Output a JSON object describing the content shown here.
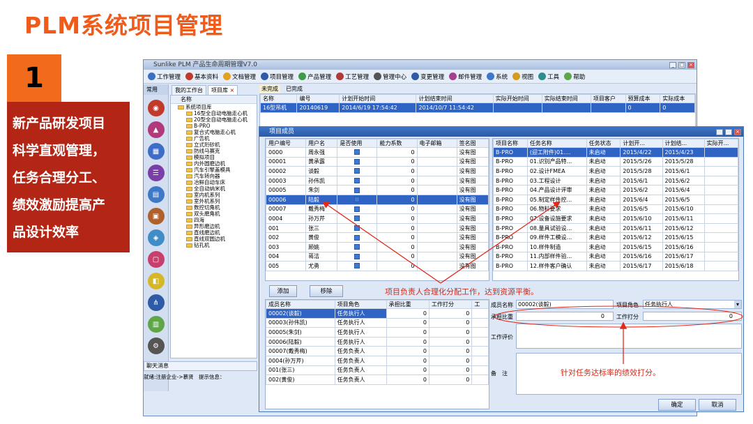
{
  "slide": {
    "title": "PLM系统项目管理",
    "number": "1",
    "lines": [
      "新产品研发项目",
      "科学直观管理，",
      "任务合理分工、",
      "绩效激励提高产",
      "品设计效率"
    ]
  },
  "app": {
    "title": "Sunlike PLM 产品生命周期管理V7.0",
    "menu": [
      "工作管理",
      "基本资料",
      "文档管理",
      "项目管理",
      "产品管理",
      "工艺管理",
      "管理中心",
      "变更管理",
      "邮件管理",
      "系统",
      "视图",
      "工具",
      "帮助"
    ],
    "sidebar_tab": "常用",
    "tabs": [
      "我的工作台",
      "项目库"
    ],
    "tree_root": "系统项目库",
    "tree_header": "名称",
    "tree_items": [
      "16型全自动电脑走心机",
      "20型全自动电脑走心机",
      "B-PRO",
      "复合式电脑走心机",
      "广告机",
      "立式珩砂机",
      "防线马赛克",
      "模拟项目",
      "内外圆磨边机",
      "汽车引擎盖模具",
      "汽车转向器",
      "冶鲜自动车床",
      "全自动纳米机",
      "室内机系列",
      "室外机系列",
      "数控切角机",
      "双头磨角机",
      "四海",
      "异形磨边机",
      "直线磨边机",
      "直线双圆边机",
      "钻孔机"
    ],
    "bottom_tab": "聊天消息",
    "status_left": "就绪:注册企业->慕贤",
    "status_right": "提示信息：",
    "sub_tabs": [
      "未完成",
      "已完成"
    ],
    "proj_headers": [
      "名称",
      "编号",
      "计划开始时间",
      "计划结束时间",
      "实际开始时间",
      "实际结束时间",
      "项目客户",
      "预算成本",
      "实际成本"
    ],
    "proj_row": [
      "16型吊机",
      "20140619",
      "2014/6/19 17:54:42",
      "2014/10/7 11:54:42",
      "",
      "",
      "",
      "0",
      "0"
    ]
  },
  "dialog": {
    "title": "项目成员",
    "member_headers": [
      "用户编号",
      "用户名",
      "是否使用",
      "能力系数",
      "电子邮箱",
      "签名图"
    ],
    "members": [
      [
        "0000",
        "周永强",
        "0",
        "没有图"
      ],
      [
        "00001",
        "黄承露",
        "0",
        "没有图"
      ],
      [
        "00002",
        "谈毅",
        "0",
        "没有图"
      ],
      [
        "00003",
        "孙伟凯",
        "0",
        "没有图"
      ],
      [
        "00005",
        "朱剑",
        "0",
        "没有图"
      ],
      [
        "00006",
        "陆毅",
        "0",
        "没有图"
      ],
      [
        "00007",
        "戴秀梅",
        "0",
        "没有图"
      ],
      [
        "0004",
        "孙万芹",
        "0",
        "没有图"
      ],
      [
        "001",
        "张三",
        "0",
        "没有图"
      ],
      [
        "002",
        "黄俊",
        "0",
        "没有图"
      ],
      [
        "003",
        "顾姚",
        "0",
        "没有图"
      ],
      [
        "004",
        "蒋洁",
        "0",
        "没有图"
      ],
      [
        "005",
        "尤勇",
        "0",
        "没有图"
      ]
    ],
    "task_headers": [
      "项目名称",
      "任务名称",
      "任务状态",
      "计划开...",
      "计划结...",
      "实际开..."
    ],
    "tasks": [
      [
        "B-PRO",
        "(迎工附件)01....",
        "未启动",
        "2015/4/22",
        "2015/4/23"
      ],
      [
        "B-PRO",
        "01.识别产品特...",
        "未启动",
        "2015/5/26",
        "2015/5/28"
      ],
      [
        "B-PRO",
        "02.设计FMEA",
        "未启动",
        "2015/5/28",
        "2015/6/1"
      ],
      [
        "B-PRO",
        "03.工程设计",
        "未启动",
        "2015/6/1",
        "2015/6/2"
      ],
      [
        "B-PRO",
        "04.产品设计评审",
        "未启动",
        "2015/6/2",
        "2015/6/4"
      ],
      [
        "B-PRO",
        "05.制定样件控...",
        "未启动",
        "2015/6/4",
        "2015/6/5"
      ],
      [
        "B-PRO",
        "06.物料要求",
        "未启动",
        "2015/6/5",
        "2015/6/10"
      ],
      [
        "B-PRO",
        "07.设备设施要求",
        "未启动",
        "2015/6/10",
        "2015/6/11"
      ],
      [
        "B-PRO",
        "08.量具试验设...",
        "未启动",
        "2015/6/11",
        "2015/6/12"
      ],
      [
        "B-PRO",
        "09.样件工模设...",
        "未启动",
        "2015/6/12",
        "2015/6/15"
      ],
      [
        "B-PRO",
        "10.样件制造",
        "未启动",
        "2015/6/15",
        "2015/6/16"
      ],
      [
        "B-PRO",
        "11.内部样件验...",
        "未启动",
        "2015/6/16",
        "2015/6/17"
      ],
      [
        "B-PRO",
        "12.样件客户确认",
        "未启动",
        "2015/6/17",
        "2015/6/18"
      ]
    ],
    "add_label": "添加",
    "remove_label": "移除",
    "assign_headers": [
      "成员名称",
      "项目角色",
      "承担比重",
      "工作打分",
      "工"
    ],
    "assignments": [
      [
        "00002(谈毅)",
        "任务执行人",
        "0",
        "0"
      ],
      [
        "00003(孙伟凯)",
        "任务执行人",
        "0",
        "0"
      ],
      [
        "00005(朱剑)",
        "任务执行人",
        "0",
        "0"
      ],
      [
        "00006(陆毅)",
        "任务执行人",
        "0",
        "0"
      ],
      [
        "00007(戴秀梅)",
        "任务负责人",
        "0",
        "0"
      ],
      [
        "0004(孙万芹)",
        "任务负责人",
        "0",
        "0"
      ],
      [
        "001(张三)",
        "任务负责人",
        "0",
        "0"
      ],
      [
        "002(黄俊)",
        "任务负责人",
        "0",
        "0"
      ]
    ],
    "form": {
      "member_label": "成员名称",
      "member_value": "00002(谈毅)",
      "role_label": "项目角色",
      "role_value": "任务执行人",
      "weight_label": "承担比重",
      "weight_value": "0",
      "score_label": "工作打分",
      "score_value": "0",
      "eval_label": "工作评价",
      "note_label": "备　注"
    },
    "ok_label": "确定",
    "cancel_label": "取消"
  },
  "annotations": {
    "top": "项目负责人合理化分配工作，达到资源平衡。",
    "bottom": "针对任务达标率的绩效打分。"
  }
}
